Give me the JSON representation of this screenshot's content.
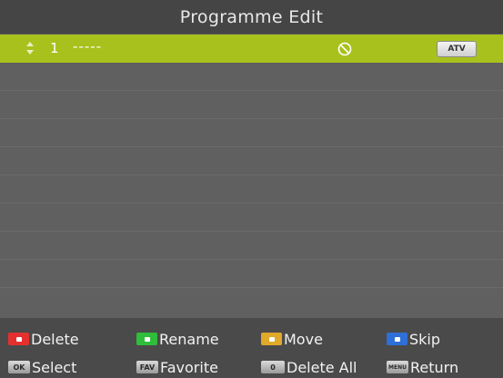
{
  "header": {
    "title": "Programme Edit"
  },
  "channels": [
    {
      "number": "1",
      "name": "-----",
      "type": "ATV",
      "skip_icon": "skip-icon",
      "selected": true
    }
  ],
  "footer": {
    "row1": [
      {
        "key": "red-key",
        "color": "#e53030",
        "label": "Delete"
      },
      {
        "key": "green-key",
        "color": "#2fbd3a",
        "label": "Rename"
      },
      {
        "key": "yellow-key",
        "color": "#e0a92a",
        "label": "Move"
      },
      {
        "key": "blue-key",
        "color": "#2f6fd8",
        "label": "Skip"
      }
    ],
    "row2": [
      {
        "key": "OK",
        "label": "Select"
      },
      {
        "key": "FAV",
        "label": "Favorite"
      },
      {
        "key": "0",
        "label": "Delete All"
      },
      {
        "key": "MENU",
        "label": "Return"
      }
    ]
  },
  "colors": {
    "selection": "#a9c11d",
    "title_bar": "#454545",
    "list_background": "#606060"
  }
}
